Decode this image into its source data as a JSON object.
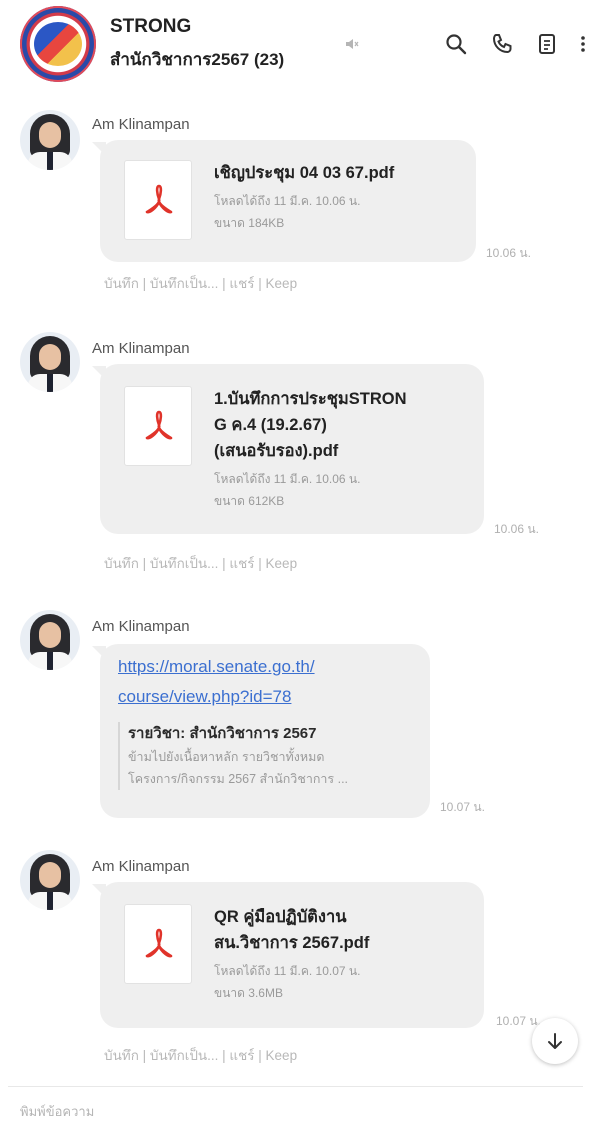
{
  "header": {
    "title": "STRONG",
    "subtitle": "สำนักวิชาการ2567 (23)",
    "icons": [
      "search-icon",
      "phone-icon",
      "notes-icon",
      "more-icon"
    ]
  },
  "messages": [
    {
      "sender": "Am Klinampan",
      "type": "file",
      "file_name_lines": [
        "เชิญประชุม 04 03 67.pdf"
      ],
      "expiry": "โหลดได้ถึง 11 มี.ค. 10.06 น.",
      "size": "ขนาด 184KB",
      "time": "10.06 น.",
      "actions": "บันทึก | บันทึกเป็น... | แชร์ | Keep"
    },
    {
      "sender": "Am Klinampan",
      "type": "file",
      "file_name_lines": [
        "1.บันทึกการประชุมSTRON",
        "G ค.4 (19.2.67)",
        "(เสนอรับรอง).pdf"
      ],
      "expiry": "โหลดได้ถึง 11 มี.ค. 10.06 น.",
      "size": "ขนาด 612KB",
      "time": "10.06 น.",
      "actions": "บันทึก | บันทึกเป็น... | แชร์ | Keep"
    },
    {
      "sender": "Am Klinampan",
      "type": "link",
      "link_lines": [
        "https://moral.senate.go.th/",
        "course/view.php?id=78"
      ],
      "preview_title": "รายวิชา: สำนักวิชาการ 2567",
      "preview_desc_lines": [
        "ข้ามไปยังเนื้อหาหลัก รายวิชาทั้งหมด",
        "โครงการ/กิจกรรม 2567 สำนักวิชาการ ..."
      ],
      "time": "10.07 น."
    },
    {
      "sender": "Am Klinampan",
      "type": "file",
      "file_name_lines": [
        "QR คู่มือปฏิบัติงาน",
        "สน.วิชาการ 2567.pdf"
      ],
      "expiry": "โหลดได้ถึง 11 มี.ค. 10.07 น.",
      "size": "ขนาด 3.6MB",
      "time": "10.07 น.",
      "actions": "บันทึก | บันทึกเป็น... | แชร์ | Keep"
    }
  ],
  "composer": {
    "placeholder": "พิมพ์ข้อความ"
  },
  "colors": {
    "bubble": "#efefef",
    "link": "#3b6fd0",
    "pdf_red": "#e0332a",
    "meta_gray": "#9a9a9a"
  }
}
